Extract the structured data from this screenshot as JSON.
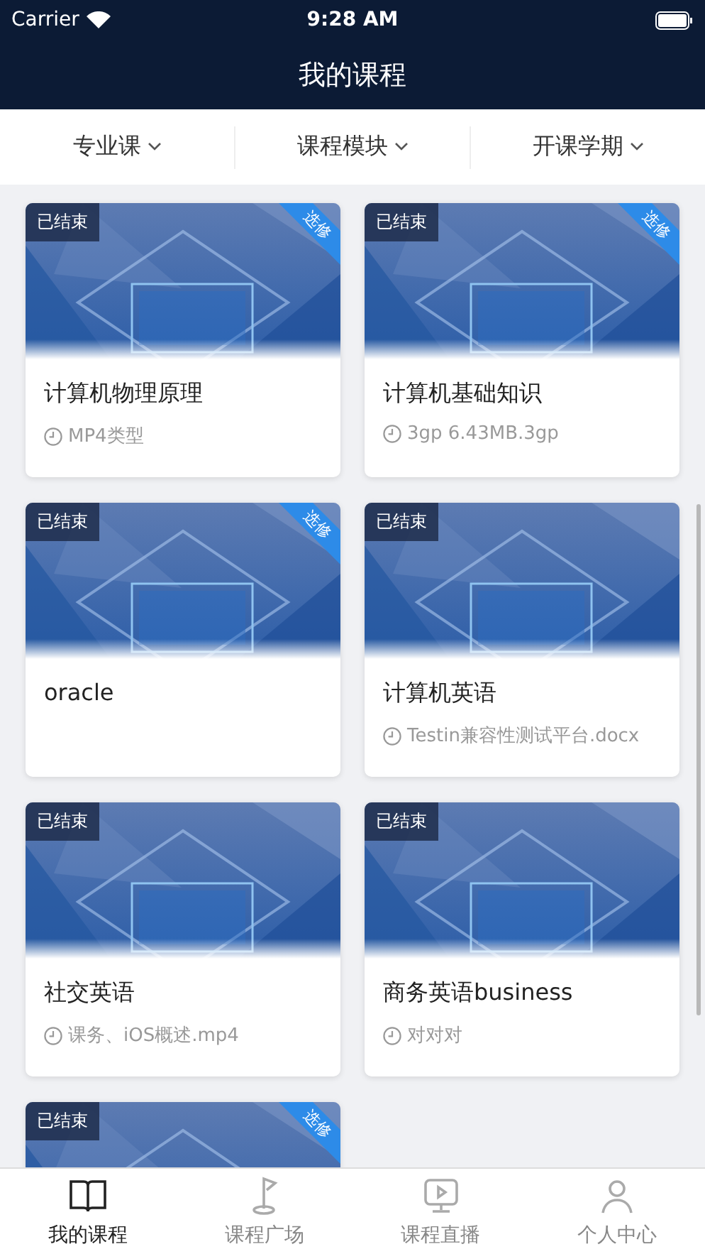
{
  "status_bar": {
    "carrier": "Carrier",
    "time": "9:28 AM"
  },
  "nav": {
    "title": "我的课程"
  },
  "filters": [
    {
      "label": "专业课"
    },
    {
      "label": "课程模块"
    },
    {
      "label": "开课学期"
    }
  ],
  "courses": [
    {
      "status": "已结束",
      "elective": "选修",
      "title": "计算机物理原理",
      "file": "MP4类型"
    },
    {
      "status": "已结束",
      "elective": "选修",
      "title": "计算机基础知识",
      "file": "3gp 6.43MB.3gp"
    },
    {
      "status": "已结束",
      "elective": "选修",
      "title": "oracle"
    },
    {
      "status": "已结束",
      "title": "计算机英语",
      "file": "Testin兼容性测试平台.docx"
    },
    {
      "status": "已结束",
      "title": "社交英语",
      "file": "课务、iOS概述.mp4"
    },
    {
      "status": "已结束",
      "title": "商务英语business",
      "file": "对对对"
    },
    {
      "status": "已结束",
      "elective": "选修"
    }
  ],
  "tab_bar": [
    {
      "label": "我的课程",
      "kind": "book",
      "selected": true
    },
    {
      "label": "课程广场",
      "kind": "flag",
      "selected": false
    },
    {
      "label": "课程直播",
      "kind": "play",
      "selected": false
    },
    {
      "label": "个人中心",
      "kind": "person",
      "selected": false
    }
  ]
}
